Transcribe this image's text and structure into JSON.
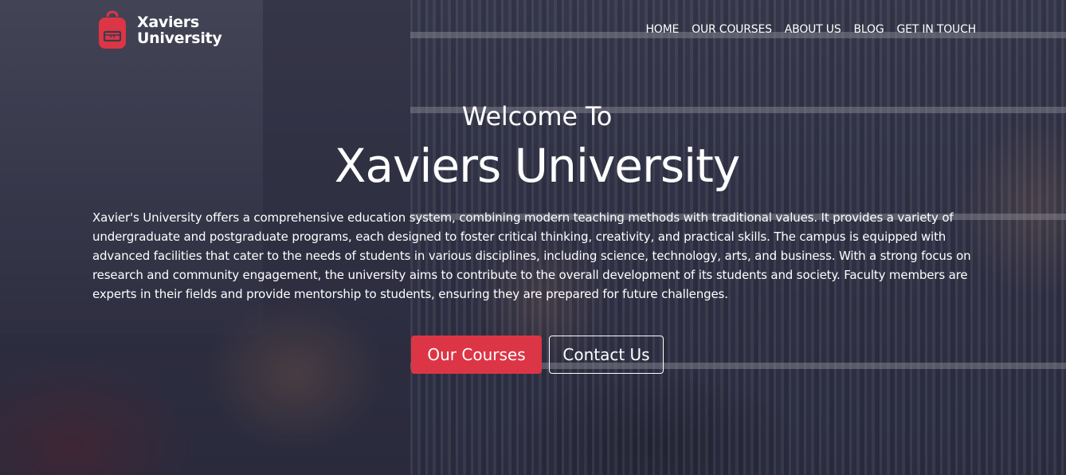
{
  "brand": {
    "name_line1": "Xaviers",
    "name_line2": "University",
    "logo_icon": "backpack-icon",
    "accent_color": "#dc3545"
  },
  "nav": {
    "items": [
      {
        "label": "HOME"
      },
      {
        "label": "OUR COURSES"
      },
      {
        "label": "ABOUT US"
      },
      {
        "label": "BLOG"
      },
      {
        "label": "GET IN TOUCH"
      }
    ]
  },
  "hero": {
    "welcome": "Welcome To",
    "title": "Xaviers University",
    "description": "Xavier's University offers a comprehensive education system, combining modern teaching methods with traditional values. It provides a variety of undergraduate and postgraduate programs, each designed to foster critical thinking, creativity, and practical skills. The campus is equipped with advanced facilities that cater to the needs of students in various disciplines, including science, technology, arts, and business. With a strong focus on research and community engagement, the university aims to contribute to the overall development of its students and society. Faculty members are experts in their fields and provide mentorship to students, ensuring they are prepared for future challenges.",
    "primary_button": "Our Courses",
    "secondary_button": "Contact Us"
  }
}
